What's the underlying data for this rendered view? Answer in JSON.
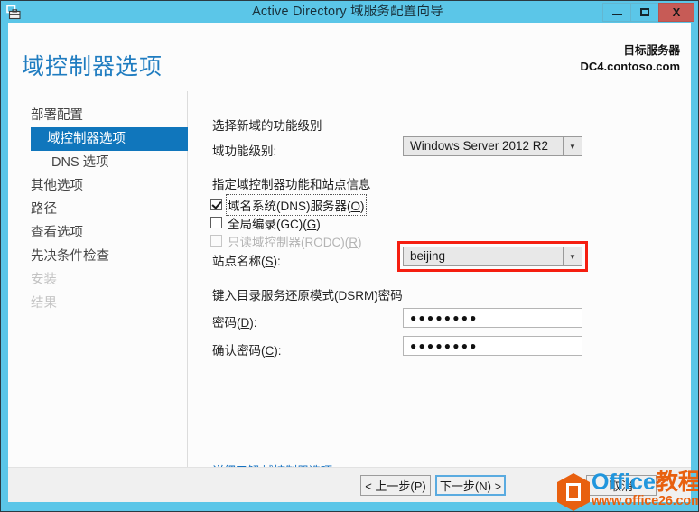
{
  "window": {
    "title": "Active Directory 域服务配置向导",
    "icon": "server-wizard-icon",
    "buttons": {
      "minimize": "minimize-icon",
      "maximize": "maximize-icon",
      "close": "X"
    }
  },
  "header": {
    "page_title": "域控制器选项",
    "target_server_label": "目标服务器",
    "target_server_name": "DC4.contoso.com"
  },
  "sidebar": {
    "items": [
      {
        "label": "部署配置",
        "state": "normal",
        "level": 0
      },
      {
        "label": "域控制器选项",
        "state": "selected",
        "level": 0
      },
      {
        "label": "DNS 选项",
        "state": "normal",
        "level": 1
      },
      {
        "label": "其他选项",
        "state": "normal",
        "level": 0
      },
      {
        "label": "路径",
        "state": "normal",
        "level": 0
      },
      {
        "label": "查看选项",
        "state": "normal",
        "level": 0
      },
      {
        "label": "先决条件检查",
        "state": "normal",
        "level": 0
      },
      {
        "label": "安装",
        "state": "disabled",
        "level": 0
      },
      {
        "label": "结果",
        "state": "disabled",
        "level": 0
      }
    ]
  },
  "main": {
    "section_functional_level": "选择新域的功能级别",
    "domain_functional_level_label": "域功能级别:",
    "domain_functional_level_value": "Windows Server 2012 R2",
    "section_capabilities": "指定域控制器功能和站点信息",
    "checkboxes": [
      {
        "label_pre": "域名系统(DNS)服务器(",
        "accel": "O",
        "label_post": ")",
        "checked": true,
        "disabled": false,
        "focused": true
      },
      {
        "label_pre": "全局编录(GC)(",
        "accel": "G",
        "label_post": ")",
        "checked": false,
        "disabled": false,
        "focused": false
      },
      {
        "label_pre": "只读域控制器(RODC)(",
        "accel": "R",
        "label_post": ")",
        "checked": false,
        "disabled": true,
        "focused": false
      }
    ],
    "site_name_label_pre": "站点名称(",
    "site_name_accel": "S",
    "site_name_label_post": "):",
    "site_name_value": "beijing",
    "section_dsrm": "键入目录服务还原模式(DSRM)密码",
    "password_label_pre": "密码(",
    "password_accel": "D",
    "password_label_post": "):",
    "password_value": "●●●●●●●●",
    "confirm_label_pre": "确认密码(",
    "confirm_accel": "C",
    "confirm_label_post": "):",
    "confirm_value": "●●●●●●●●",
    "help_link_lead": "详细了解",
    "help_link_topic": "域控制器选项"
  },
  "footer": {
    "prev_label": "< 上一步(P)",
    "next_label": "下一步(N) >",
    "cancel_label": "取消"
  },
  "watermark": {
    "brand_en": "Office",
    "brand_cn": "教程网",
    "url": "www.office26.com"
  },
  "colors": {
    "titlebar": "#5bc6e8",
    "accent_blue": "#1076bc",
    "title_text_blue": "#1f7cc0",
    "close_red": "#c75b56",
    "highlight_red": "#f51e10",
    "link_blue": "#1571c0",
    "watermark_blue": "#2196dd",
    "watermark_orange": "#e8600f"
  }
}
